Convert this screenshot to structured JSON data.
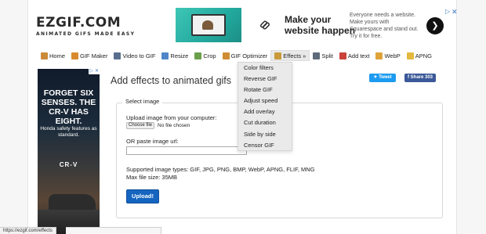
{
  "logo": {
    "title": "EZGIF.COM",
    "tagline": "ANIMATED GIFS MADE EASY"
  },
  "top_ad": {
    "headline": "Make your website happen",
    "body": "Everyone needs a website. Make yours with Squarespace and stand out. Try it for free.",
    "go_icon": "arrow-right-icon"
  },
  "nav": {
    "items": [
      {
        "label": "Home",
        "icon": "home-icon"
      },
      {
        "label": "GIF Maker",
        "icon": "gif-maker-icon"
      },
      {
        "label": "Video to GIF",
        "icon": "video-icon"
      },
      {
        "label": "Resize",
        "icon": "resize-icon"
      },
      {
        "label": "Crop",
        "icon": "crop-icon"
      },
      {
        "label": "GIF Optimizer",
        "icon": "optimizer-icon"
      },
      {
        "label": "Effects »",
        "icon": "effects-icon"
      },
      {
        "label": "Split",
        "icon": "split-icon"
      },
      {
        "label": "Add text",
        "icon": "text-icon"
      },
      {
        "label": "WebP",
        "icon": "webp-icon"
      },
      {
        "label": "APNG",
        "icon": "apng-icon"
      }
    ],
    "active_index": 6
  },
  "effects_menu": [
    "Color filters",
    "Reverse GIF",
    "Rotate GIF",
    "Adjust speed",
    "Add overlay",
    "Cut duration",
    "Side by side",
    "Censor GIF"
  ],
  "side_ad": {
    "headline": "FORGET SIX SENSES. THE CR-V HAS EIGHT.",
    "sub": "Honda safety features as standard.",
    "model": "CR-V"
  },
  "main": {
    "title": "Add effects to animated gifs",
    "tweet": "Tweet",
    "share": "Share 303"
  },
  "form": {
    "legend": "Select image",
    "upload_label": "Upload image from your computer:",
    "choose_file": "Choose file",
    "no_file": "No file chosen",
    "paste_label": "OR paste image url:",
    "url_value": "",
    "supported": "Supported image types: GIF, JPG, PNG, BMP, WebP, APNG, FLIF, MNG",
    "max_size": "Max file size: 35MB",
    "upload_button": "Upload!"
  },
  "status_bar": {
    "url": "https://ezgif.com/effects"
  },
  "colors": {
    "upload_blue": "#1565c0",
    "tweet_blue": "#1d9bf0",
    "facebook_blue": "#3b5998"
  }
}
